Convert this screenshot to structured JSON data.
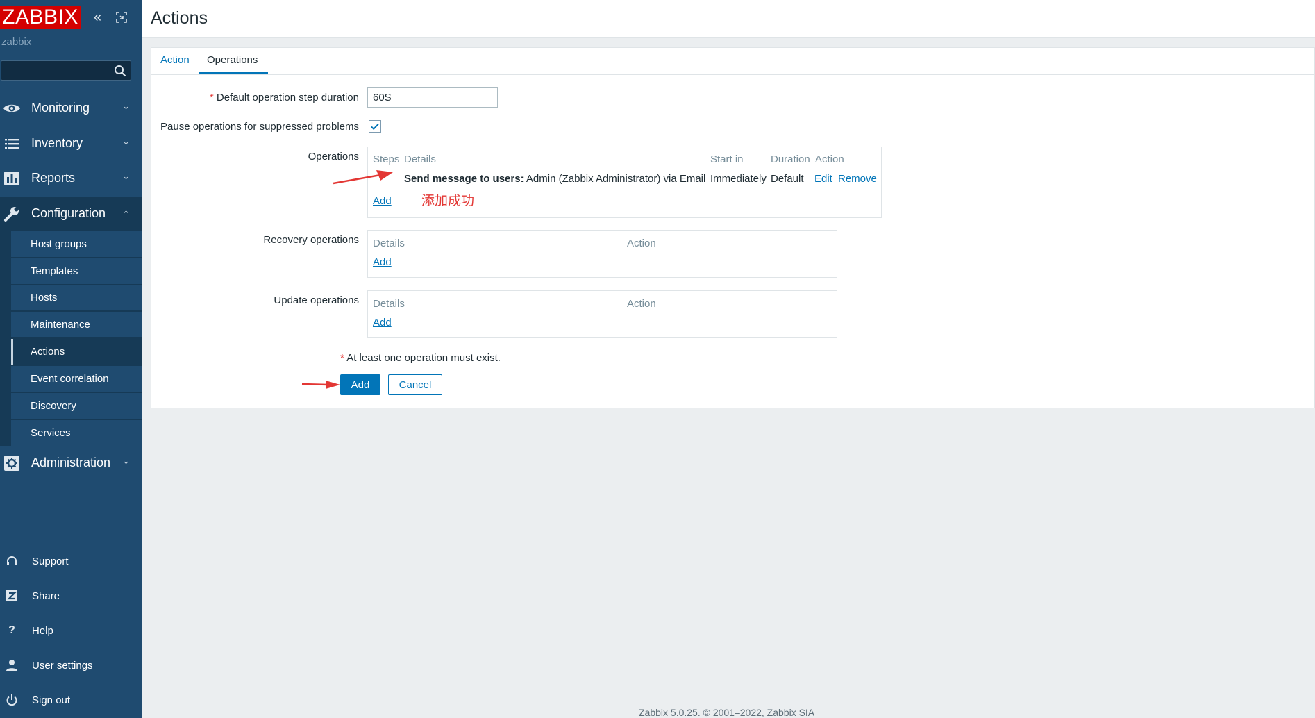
{
  "sidebar": {
    "logo": "ZABBIX",
    "server_name": "zabbix",
    "menu": [
      {
        "label": "Monitoring",
        "icon": "eye-icon",
        "expanded": false
      },
      {
        "label": "Inventory",
        "icon": "list-icon",
        "expanded": false
      },
      {
        "label": "Reports",
        "icon": "bar-chart-icon",
        "expanded": false
      },
      {
        "label": "Configuration",
        "icon": "wrench-icon",
        "expanded": true
      },
      {
        "label": "Administration",
        "icon": "gear-icon",
        "expanded": false
      }
    ],
    "config_items": [
      "Host groups",
      "Templates",
      "Hosts",
      "Maintenance",
      "Actions",
      "Event correlation",
      "Discovery",
      "Services"
    ],
    "active_item": "Actions",
    "bottom": [
      {
        "label": "Support",
        "icon": "headset-icon"
      },
      {
        "label": "Share",
        "icon": "share-icon"
      },
      {
        "label": "Help",
        "icon": "help-icon"
      },
      {
        "label": "User settings",
        "icon": "user-icon"
      },
      {
        "label": "Sign out",
        "icon": "power-icon"
      }
    ]
  },
  "header": {
    "title": "Actions"
  },
  "tabs": [
    {
      "label": "Action",
      "active": false
    },
    {
      "label": "Operations",
      "active": true
    }
  ],
  "form": {
    "step_duration_label": "Default operation step duration",
    "step_duration_value": "60S",
    "pause_label": "Pause operations for suppressed problems",
    "pause_checked": true,
    "operations": {
      "label": "Operations",
      "columns": [
        "Steps",
        "Details",
        "Start in",
        "Duration",
        "Action"
      ],
      "rows": [
        {
          "steps": "",
          "details_bold": "Send message to users:",
          "details_text": "Admin (Zabbix Administrator) via Email",
          "start_in": "Immediately",
          "duration": "Default",
          "actions": [
            "Edit",
            "Remove"
          ]
        }
      ],
      "add_link": "Add"
    },
    "recovery_operations": {
      "label": "Recovery operations",
      "columns": [
        "Details",
        "Action"
      ],
      "add_link": "Add"
    },
    "update_operations": {
      "label": "Update operations",
      "columns": [
        "Details",
        "Action"
      ],
      "add_link": "Add"
    },
    "hint": "At least one operation must exist.",
    "add_button": "Add",
    "cancel_button": "Cancel"
  },
  "annotation": "添加成功",
  "colors": {
    "sidebar": "#1f4b70",
    "accent": "#0275b8",
    "logo": "#d40000",
    "annotation_red": "#e33734"
  },
  "footer": "Zabbix 5.0.25. © 2001–2022, Zabbix SIA"
}
